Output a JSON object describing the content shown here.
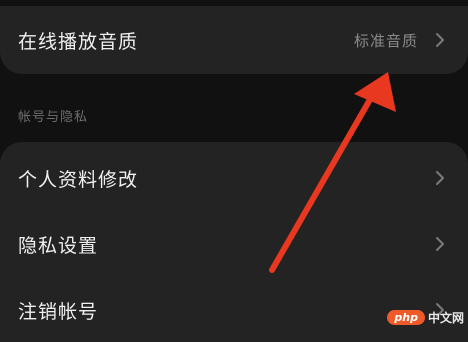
{
  "playback": {
    "label": "在线播放音质",
    "value": "标准音质",
    "chevron_icon": "chevron-right-icon"
  },
  "section_header": "帐号与隐私",
  "account_items": [
    {
      "label": "个人资料修改",
      "icon": "chevron-right-icon"
    },
    {
      "label": "隐私设置",
      "icon": "chevron-right-icon"
    },
    {
      "label": "注销帐号",
      "icon": "chevron-right-icon"
    }
  ],
  "annotation": {
    "icon": "red-arrow-icon",
    "color": "#e8381f"
  },
  "watermark": {
    "logo": "php",
    "text": "中文网",
    "color": "#ef5a2a"
  },
  "colors": {
    "background": "#111111",
    "card": "#232323",
    "secondary_text": "#8a8a8a"
  }
}
